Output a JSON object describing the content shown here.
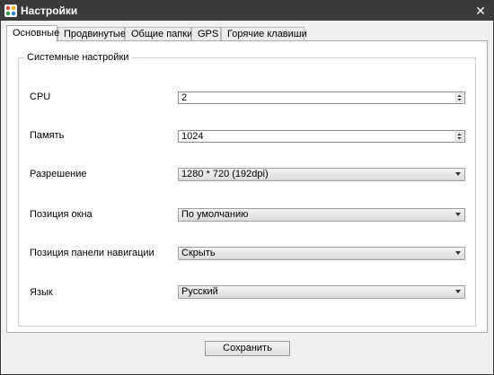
{
  "window": {
    "title": "Настройки",
    "close_glyph": "✕"
  },
  "tabs": [
    {
      "label": "Основные",
      "active": true
    },
    {
      "label": "Продвинутые",
      "active": false
    },
    {
      "label": "Общие папки",
      "active": false
    },
    {
      "label": "GPS",
      "active": false
    },
    {
      "label": "Горячие клавиши",
      "active": false
    }
  ],
  "system_settings": {
    "title": "Системные настройки",
    "cpu": {
      "label": "CPU",
      "value": "2"
    },
    "memory": {
      "label": "Память",
      "value": "1024"
    },
    "resolution": {
      "label": "Разрешение",
      "value": "1280 * 720 (192dpi)"
    },
    "window_position": {
      "label": "Позиция окна",
      "value": "По умолчанию"
    },
    "nav_panel_position": {
      "label": "Позиция панели навигации",
      "value": "Скрыть"
    },
    "language": {
      "label": "Язык",
      "value": "Русский"
    }
  },
  "footer": {
    "save_label": "Сохранить"
  }
}
